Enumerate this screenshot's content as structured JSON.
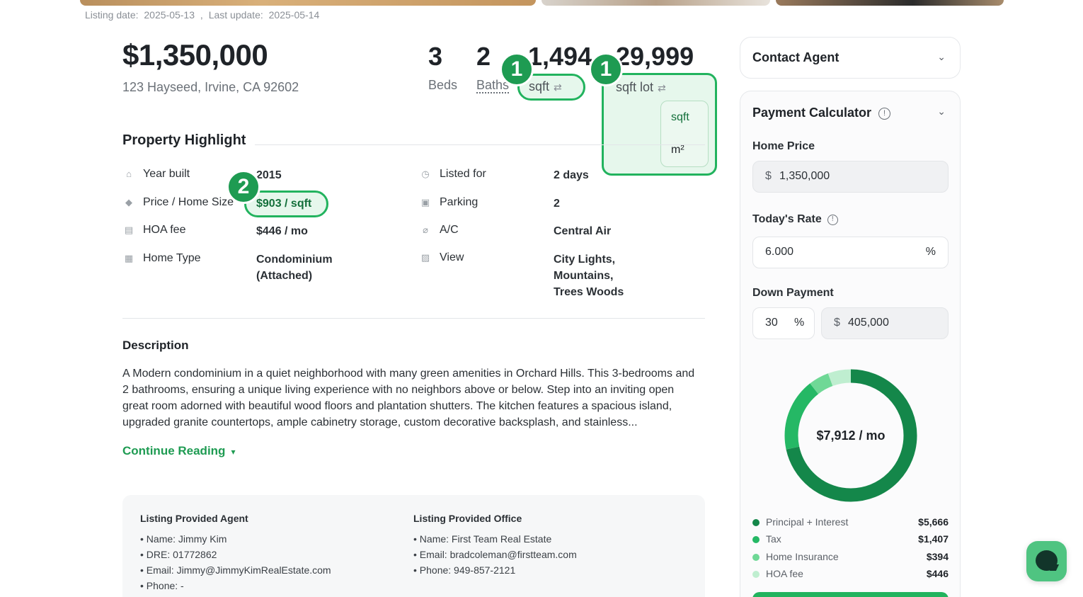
{
  "listing": {
    "listing_date_label": "Listing date:",
    "listing_date": "2025-05-13",
    "separator": ",",
    "last_update_label": "Last update:",
    "last_update": "2025-05-14"
  },
  "header": {
    "price": "$1,350,000",
    "address": "123 Hayseed, Irvine, CA 92602",
    "stats": {
      "beds_value": "3",
      "beds_label": "Beds",
      "baths_value": "2",
      "baths_label": "Baths",
      "sqft_value": "1,494",
      "sqft_label": "sqft",
      "lot_value": "29,999",
      "lot_label": "sqft lot"
    },
    "unit_menu": {
      "options": [
        "sqft",
        "m²"
      ]
    },
    "swap_icon": "swap-icon",
    "badges": [
      "1",
      "1",
      "2"
    ],
    "accent_color": "#22b35e"
  },
  "highlight": {
    "title": "Property Highlight",
    "left": [
      {
        "icon": "year-built-icon",
        "label": "Year built",
        "value": "2015"
      },
      {
        "icon": "price-tag-icon",
        "label": "Price / Home Size",
        "value": "$903 / sqft"
      },
      {
        "icon": "hoa-icon",
        "label": "HOA fee",
        "value": "$446 / mo"
      },
      {
        "icon": "home-type-icon",
        "label": "Home Type",
        "value_lines": [
          "Condominium",
          "(Attached)"
        ]
      }
    ],
    "right": [
      {
        "icon": "clock-icon",
        "label": "Listed for",
        "value": "2 days"
      },
      {
        "icon": "parking-icon",
        "label": "Parking",
        "value": "2"
      },
      {
        "icon": "thermometer-icon",
        "label": "A/C",
        "value": "Central Air"
      },
      {
        "icon": "view-icon",
        "label": "View",
        "value_lines": [
          "City Lights,",
          "Mountains,",
          "Trees Woods"
        ]
      }
    ]
  },
  "description": {
    "title": "Description",
    "text": "A Modern condominium in a quiet neighborhood with many green amenities in Orchard Hills. This 3-bedrooms and 2 bathrooms, ensuring a unique living experience with no neighbors above or below. Step into an inviting open great room adorned with beautiful wood floors and plantation shutters. The kitchen features a spacious island, upgraded granite countertops, ample cabinetry storage, custom decorative backsplash, and stainless...",
    "continue_label": "Continue Reading"
  },
  "provided": {
    "agent": {
      "title": "Listing Provided Agent",
      "items": [
        "• Name: Jimmy Kim",
        "• DRE: 01772862",
        "• Email: Jimmy@JimmyKimRealEstate.com",
        "• Phone: -"
      ]
    },
    "office": {
      "title": "Listing Provided Office",
      "items": [
        "• Name: First Team Real Estate",
        "• Email: bradcoleman@firstteam.com",
        "• Phone: 949-857-2121"
      ]
    }
  },
  "contact": {
    "title": "Contact Agent"
  },
  "calculator": {
    "title": "Payment Calculator",
    "home_price_label": "Home Price",
    "home_price_prefix": "$",
    "home_price": "1,350,000",
    "rate_label": "Today's Rate",
    "rate": "6.000",
    "rate_suffix": "%",
    "down_label": "Down Payment",
    "down_percent": "30",
    "down_percent_suffix": "%",
    "down_amount_prefix": "$",
    "down_amount": "405,000",
    "monthly": "$7,912 / mo",
    "breakdown": [
      {
        "name": "Principal + Interest",
        "amount": "$5,666",
        "value": 5666,
        "color": "#14874a"
      },
      {
        "name": "Tax",
        "amount": "$1,407",
        "value": 1407,
        "color": "#25b865"
      },
      {
        "name": "Home Insurance",
        "amount": "$394",
        "value": 394,
        "color": "#6fd896"
      },
      {
        "name": "HOA fee",
        "amount": "$446",
        "value": 446,
        "color": "#bfeed0"
      }
    ]
  }
}
